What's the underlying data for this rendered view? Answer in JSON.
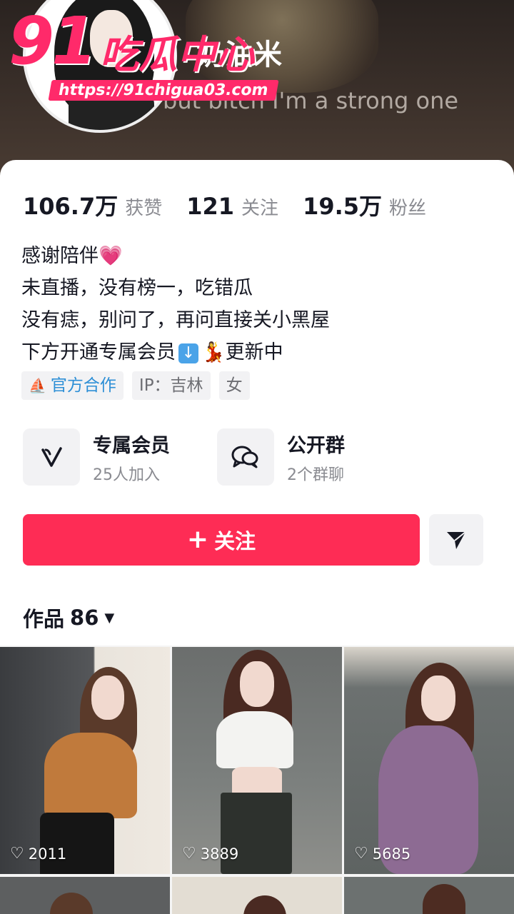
{
  "header": {
    "username": "奶油米",
    "tagline": "but bitch I'm a strong one"
  },
  "watermark": {
    "brand_number": "91",
    "brand_text": "吃瓜中心",
    "url": "https://91chigua03.com"
  },
  "stats": [
    {
      "value": "106.7万",
      "label": "获赞"
    },
    {
      "value": "121",
      "label": "关注"
    },
    {
      "value": "19.5万",
      "label": "粉丝"
    }
  ],
  "bio": {
    "line1": "感谢陪伴",
    "line2": "未直播，没有榜一，吃错瓜",
    "line3": "没有痣，别问了，再问直接关小黑屋",
    "line4_start": "下方开通专属会员",
    "line4_end": "更新中"
  },
  "tags": [
    {
      "label": "官方合作"
    },
    {
      "label": "IP：吉林"
    },
    {
      "label": "女"
    }
  ],
  "features": {
    "membership": {
      "title": "专属会员",
      "subtitle": "25人加入"
    },
    "group": {
      "title": "公开群",
      "subtitle": "2个群聊"
    }
  },
  "actions": {
    "follow_label": "关注"
  },
  "works": {
    "label": "作品",
    "count": "86"
  },
  "videos": [
    {
      "likes": "2011"
    },
    {
      "likes": "3889"
    },
    {
      "likes": "5685"
    }
  ],
  "colors": {
    "accent": "#fe2c55",
    "watermark": "#ff2a6a",
    "official_tag": "#2d8fd6"
  },
  "icons": {
    "membership": "v-logo-icon",
    "group": "chat-bubbles-icon",
    "share": "send-arrow-icon",
    "likes": "heart-outline-icon"
  }
}
